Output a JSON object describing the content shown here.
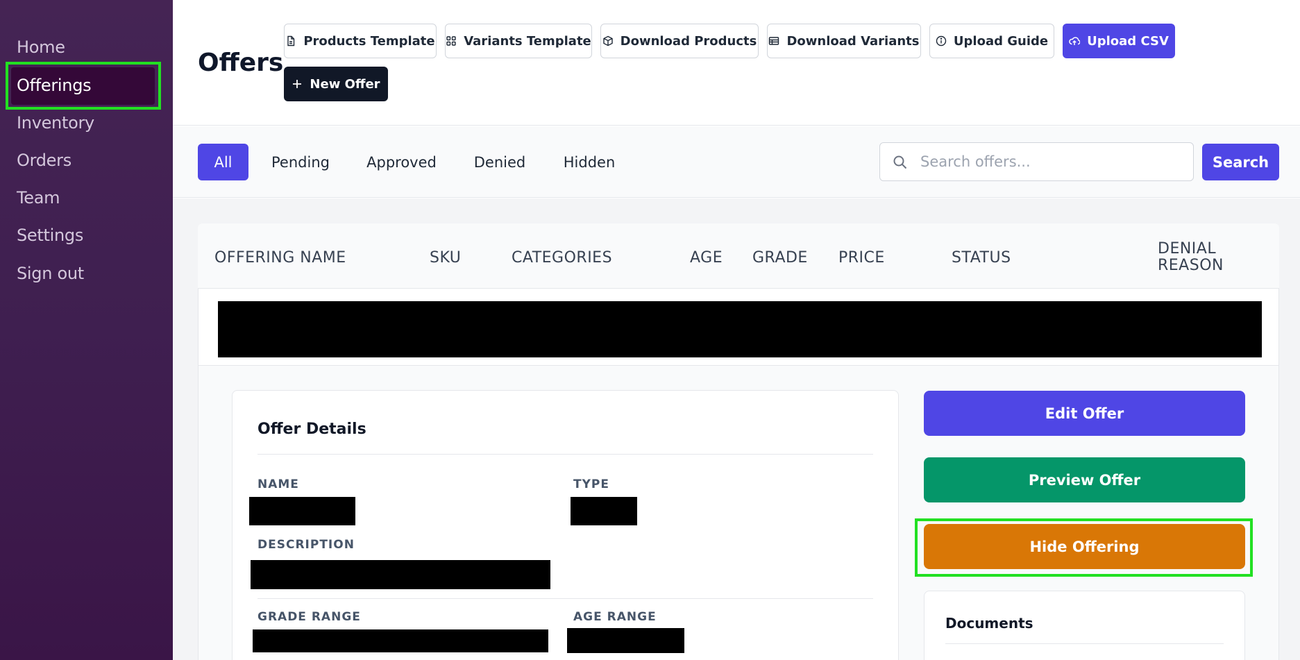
{
  "sidebar": {
    "items": [
      {
        "label": "Home"
      },
      {
        "label": "Offerings"
      },
      {
        "label": "Inventory"
      },
      {
        "label": "Orders"
      },
      {
        "label": "Team"
      },
      {
        "label": "Settings"
      },
      {
        "label": "Sign out"
      }
    ],
    "active": "Offerings"
  },
  "header": {
    "title": "Offers",
    "buttons": {
      "products_template": "Products Template",
      "variants_template": "Variants Template",
      "download_products": "Download Products",
      "download_variants": "Download Variants",
      "upload_guide": "Upload Guide",
      "upload_csv": "Upload CSV",
      "new_offer": "New Offer"
    }
  },
  "filters": {
    "tabs": [
      {
        "label": "All"
      },
      {
        "label": "Pending"
      },
      {
        "label": "Approved"
      },
      {
        "label": "Denied"
      },
      {
        "label": "Hidden"
      }
    ],
    "active": "All",
    "search_placeholder": "Search offers...",
    "search_button": "Search"
  },
  "table": {
    "columns": {
      "name": "OFFERING NAME",
      "sku": "SKU",
      "categories": "CATEGORIES",
      "age": "AGE",
      "grade": "GRADE",
      "price": "PRICE",
      "status": "STATUS",
      "denial_line1": "DENIAL",
      "denial_line2": "REASON"
    }
  },
  "details": {
    "title": "Offer Details",
    "labels": {
      "name": "NAME",
      "type": "TYPE",
      "description": "DESCRIPTION",
      "grade_range": "GRADE RANGE",
      "age_range": "AGE RANGE"
    }
  },
  "actions": {
    "edit": "Edit Offer",
    "preview": "Preview Offer",
    "hide": "Hide Offering"
  },
  "documents": {
    "title": "Documents"
  },
  "colors": {
    "sidebar_bg": "#432253",
    "primary": "#4f46e5",
    "preview": "#059669",
    "hide": "#d97706",
    "highlight": "#22e022",
    "dark_button": "#111827"
  }
}
